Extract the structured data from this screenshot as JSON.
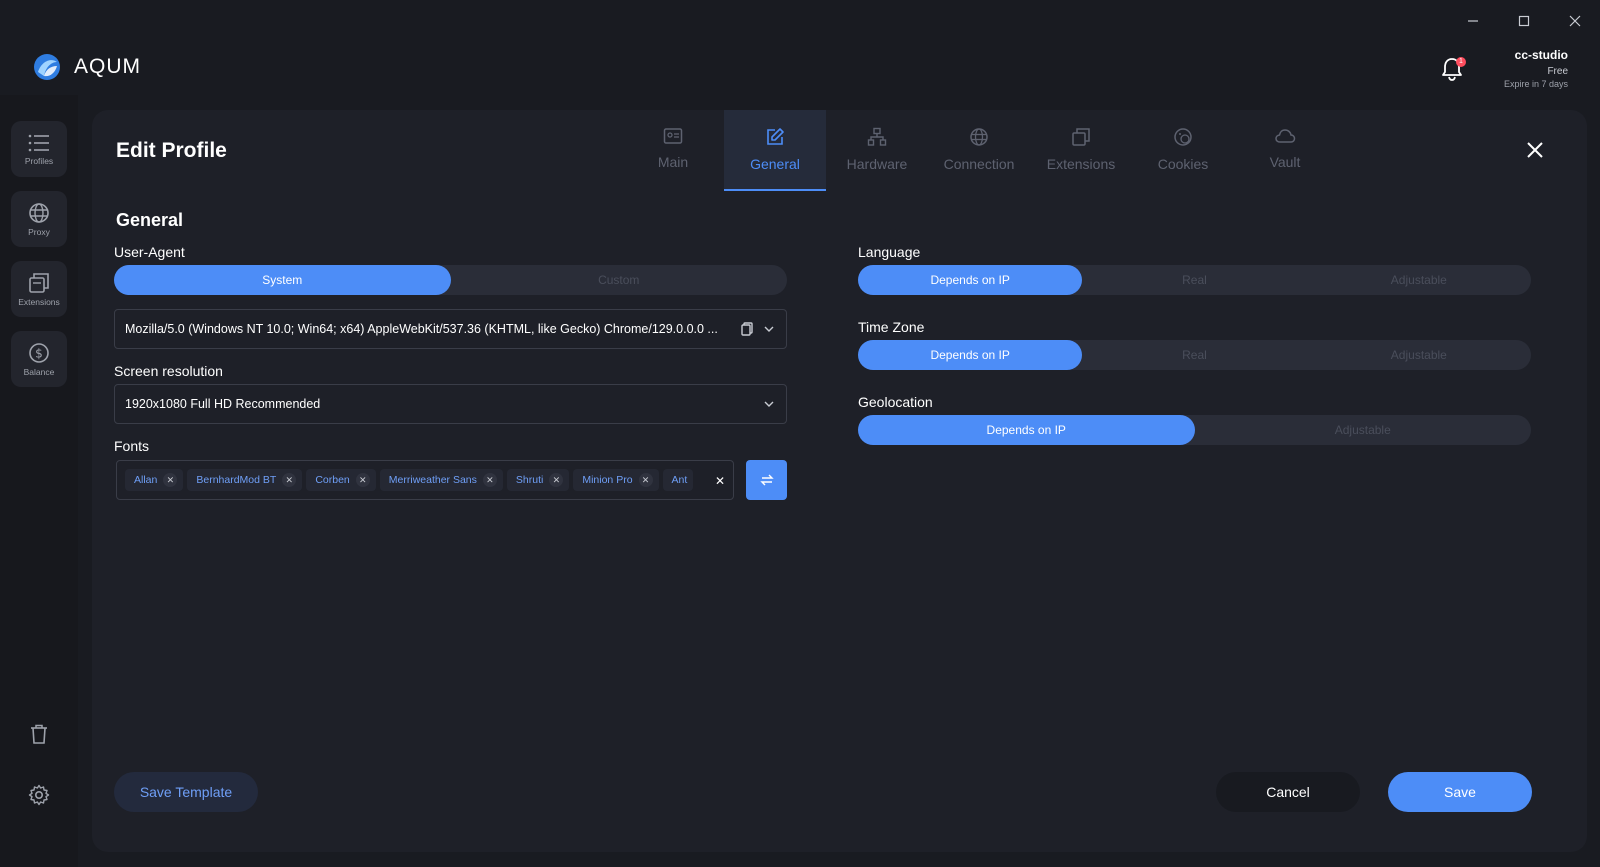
{
  "app": {
    "name": "AQUM"
  },
  "user": {
    "name": "cc-studio",
    "plan": "Free",
    "expire": "Expire in 7 days",
    "notifications": "1"
  },
  "sidebar": {
    "items": [
      {
        "label": "Profiles",
        "icon": "list-icon"
      },
      {
        "label": "Proxy",
        "icon": "globe-icon"
      },
      {
        "label": "Extensions",
        "icon": "extensions-icon"
      },
      {
        "label": "Balance",
        "icon": "dollar-icon"
      }
    ]
  },
  "dialog": {
    "title": "Edit Profile",
    "tabs": [
      {
        "label": "Main",
        "icon": "id-card-icon"
      },
      {
        "label": "General",
        "icon": "edit-icon",
        "active": true
      },
      {
        "label": "Hardware",
        "icon": "hardware-icon"
      },
      {
        "label": "Connection",
        "icon": "globe-icon"
      },
      {
        "label": "Extensions",
        "icon": "extensions-icon"
      },
      {
        "label": "Cookies",
        "icon": "cookie-icon"
      },
      {
        "label": "Vault",
        "icon": "cloud-icon"
      }
    ],
    "section_title": "General",
    "user_agent": {
      "label": "User-Agent",
      "options": [
        "System",
        "Custom"
      ],
      "selected": "System",
      "value": "Mozilla/5.0 (Windows NT 10.0; Win64; x64) AppleWebKit/537.36 (KHTML, like Gecko) Chrome/129.0.0.0 ..."
    },
    "screen_resolution": {
      "label": "Screen resolution",
      "value": "1920x1080 Full HD Recommended"
    },
    "fonts": {
      "label": "Fonts",
      "chips": [
        "Allan",
        "BernhardMod BT",
        "Corben",
        "Merriweather Sans",
        "Shruti",
        "Minion Pro",
        "Ant"
      ]
    },
    "language": {
      "label": "Language",
      "options": [
        "Depends on IP",
        "Real",
        "Adjustable"
      ],
      "selected": "Depends on IP"
    },
    "timezone": {
      "label": "Time Zone",
      "options": [
        "Depends on IP",
        "Real",
        "Adjustable"
      ],
      "selected": "Depends on IP"
    },
    "geolocation": {
      "label": "Geolocation",
      "options": [
        "Depends on IP",
        "Adjustable"
      ],
      "selected": "Depends on IP"
    },
    "buttons": {
      "save_template": "Save Template",
      "cancel": "Cancel",
      "save": "Save"
    }
  },
  "colors": {
    "accent": "#4d8df7",
    "background": "#191b21",
    "panel": "#1e2028",
    "badge": "#ff4d5e"
  }
}
